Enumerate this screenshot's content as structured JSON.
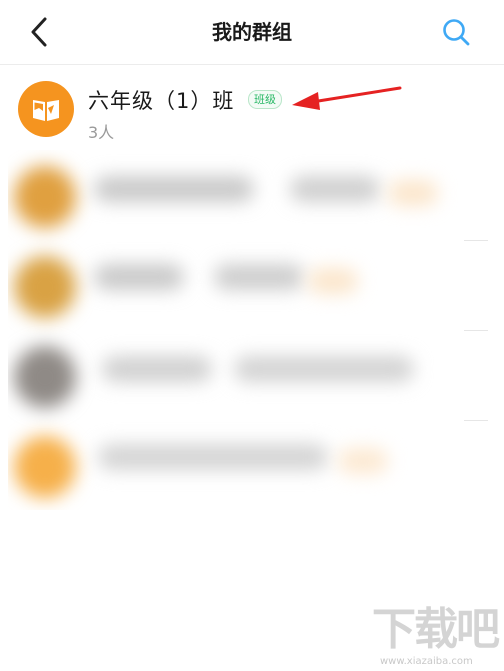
{
  "nav": {
    "back_icon": "chevron-left-icon",
    "title": "我的群组",
    "search_icon": "search-icon",
    "accent": "#3fa9f5"
  },
  "group": {
    "name": "六年级（1）班",
    "badge": "班级",
    "member_count": "3人",
    "avatar_icon": "open-book-icon",
    "avatar_color": "#f5941f",
    "badge_color": "#29b866"
  },
  "blurred_items": [
    {
      "avatar_color": "#e0a040"
    },
    {
      "avatar_color": "#d9a244"
    },
    {
      "avatar_color": "#8f8a86"
    },
    {
      "avatar_color": "#f6b04a"
    }
  ],
  "annotation": {
    "arrow_color": "#e52222"
  },
  "watermark": {
    "brand": "下载吧",
    "url": "www.xiazaiba.com"
  }
}
